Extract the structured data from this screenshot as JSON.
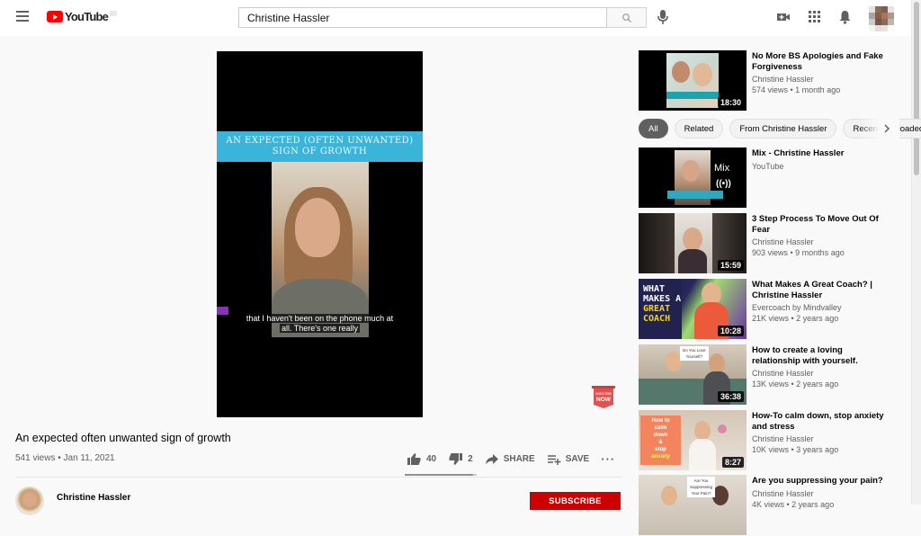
{
  "header": {
    "logo_text": "YouTube",
    "search_value": "Christine Hassler",
    "search_placeholder": "Search",
    "icons": [
      "menu-icon",
      "search-icon",
      "mic-icon",
      "create-video-icon",
      "apps-grid-icon",
      "notifications-bell-icon",
      "avatar"
    ]
  },
  "player": {
    "banner_line1": "AN EXPECTED (OFTEN UNWANTED)",
    "banner_line2": "SIGN OF GROWTH",
    "caption_line1": "that I haven't been on the phone much at",
    "caption_line2": "all. There's one really",
    "subscribe_badge_line1": "SUBSCRIBE",
    "subscribe_badge_line2": "NOW"
  },
  "video": {
    "title": "An expected often unwanted sign of growth",
    "meta": "541 views • Jan 11, 2021",
    "likes": "40",
    "dislikes": "2",
    "like_ratio": 0.95,
    "share_label": "SHARE",
    "save_label": "SAVE",
    "more_label": "···"
  },
  "channel": {
    "name": "Christine Hassler",
    "subscribe_label": "SUBSCRIBE"
  },
  "chips": [
    {
      "label": "All",
      "active": true
    },
    {
      "label": "Related",
      "active": false
    },
    {
      "label": "From Christine Hassler",
      "active": false
    },
    {
      "label": "Recently uploaded",
      "active": false
    }
  ],
  "recommendations": [
    {
      "title": "No More BS Apologies and Fake Forgiveness",
      "channel": "Christine Hassler",
      "meta": "574 views • 1 month ago",
      "duration": "18:30"
    },
    {
      "title": "Mix - Christine Hassler",
      "channel": "YouTube",
      "meta": "",
      "duration": "",
      "mix_label": "Mix"
    },
    {
      "title": "3 Step Process To Move Out Of Fear",
      "channel": "Christine Hassler",
      "meta": "903 views • 9 months ago",
      "duration": "15:59"
    },
    {
      "title": "What Makes A Great Coach? | Christine Hassler",
      "channel": "Evercoach by Mindvalley",
      "meta": "21K views • 2 years ago",
      "duration": "10:28",
      "thumb_text": [
        "WHAT",
        "MAKES A",
        "GREAT",
        "COACH"
      ]
    },
    {
      "title": "How to create a loving relationship with yourself.",
      "channel": "Christine Hassler",
      "meta": "13K views • 2 years ago",
      "duration": "36:38",
      "thumb_text": [
        "Do You Love",
        "Yourself?"
      ]
    },
    {
      "title": "How-To calm down, stop anxiety and stress",
      "channel": "Christine Hassler",
      "meta": "10K views • 3 years ago",
      "duration": "8:27",
      "thumb_text": [
        "How to",
        "calm",
        "down",
        "&",
        "stop",
        "anxiety"
      ]
    },
    {
      "title": "Are you suppressing your pain?",
      "channel": "Christine Hassler",
      "meta": "4K views • 2 years ago",
      "duration": "",
      "thumb_text": [
        "Are You",
        "Suppressing",
        "Your Pain?"
      ]
    }
  ],
  "colors": {
    "brand_red": "#ff0000",
    "subscribe_red": "#cc0000",
    "banner_blue": "#3ab5d9",
    "chip_active": "#606060"
  }
}
